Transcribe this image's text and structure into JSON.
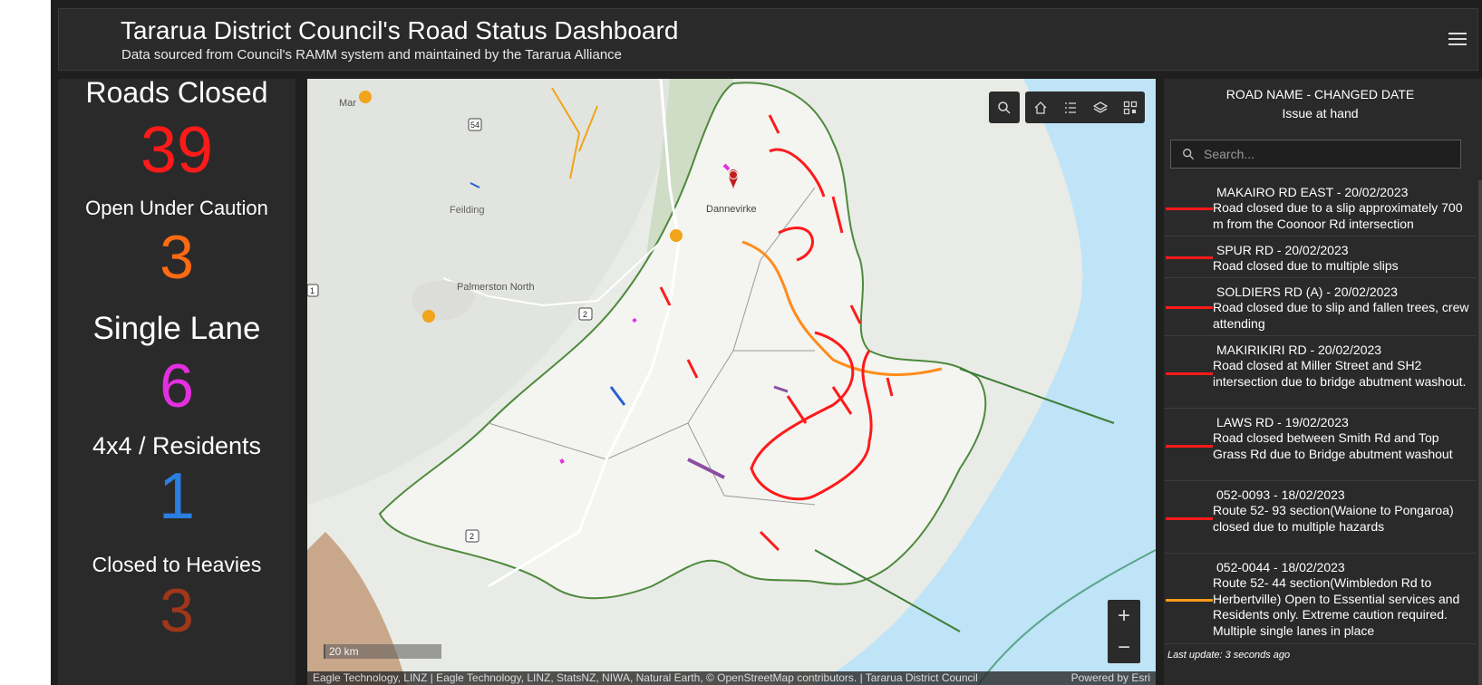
{
  "header": {
    "title": "Tararua District Council's Road Status Dashboard",
    "subtitle": "Data sourced from Council's RAMM system and maintained by the Tararua Alliance"
  },
  "stats": [
    {
      "label": "Roads Closed",
      "value": "39",
      "color": "#ff1a1a"
    },
    {
      "label": "Open Under Caution",
      "value": "3",
      "color": "#ff6a13"
    },
    {
      "label": "Single Lane",
      "value": "6",
      "color": "#e32fe0"
    },
    {
      "label": "4x4 / Residents",
      "value": "1",
      "color": "#2a7fe0"
    },
    {
      "label": "Closed to Heavies",
      "value": "3",
      "color": "#a0361a"
    }
  ],
  "map": {
    "place_labels": [
      "Feilding",
      "Dannevirke",
      "Palmerston North",
      "Mar"
    ],
    "route_shields": [
      "54",
      "2",
      "2",
      "1"
    ],
    "scale": "20 km",
    "attribution": "Eagle Technology, LINZ | Eagle Technology, LINZ, StatsNZ, NIWA, Natural Earth, © OpenStreetMap contributors. | Tararua District Council",
    "powered_by": "Powered by Esri",
    "zoom_in": "+",
    "zoom_out": "−"
  },
  "list": {
    "header_line1": "ROAD NAME - CHANGED DATE",
    "header_line2": "Issue at hand",
    "search_placeholder": "Search...",
    "items": [
      {
        "title": "MAKAIRO RD EAST - 20/02/2023",
        "desc": "Road closed due to a slip approximately 700 m from the Coonoor Rd intersection",
        "color": "#ff1a1a"
      },
      {
        "title": "SPUR RD - 20/02/2023",
        "desc": "Road closed due to multiple slips",
        "color": "#ff1a1a"
      },
      {
        "title": "SOLDIERS RD (A) - 20/02/2023",
        "desc": "Road closed due to slip and fallen trees, crew attending",
        "color": "#ff1a1a"
      },
      {
        "title": "MAKIRIKIRI RD - 20/02/2023",
        "desc": "Road closed at Miller Street and SH2 intersection due to bridge abutment washout.",
        "color": "#ff1a1a"
      },
      {
        "title": "LAWS RD - 19/02/2023",
        "desc": "Road closed between Smith Rd and Top Grass Rd due to Bridge abutment washout",
        "color": "#ff1a1a"
      },
      {
        "title": "052-0093 - 18/02/2023",
        "desc": "Route 52- 93 section(Waione to Pongaroa) closed due to multiple hazards",
        "color": "#ff1a1a"
      },
      {
        "title": "052-0044 - 18/02/2023",
        "desc": "Route 52- 44 section(Wimbledon Rd to Herbertville) Open to Essential services and Residents only. Extreme caution required. Multiple single lanes in place",
        "color": "#ff9a1a"
      }
    ],
    "last_update": "Last update: 3 seconds ago"
  },
  "icons": [
    "menu-icon",
    "search-icon",
    "home-icon",
    "legend-icon",
    "layers-icon",
    "qr-icon",
    "warning-marker-icon"
  ]
}
